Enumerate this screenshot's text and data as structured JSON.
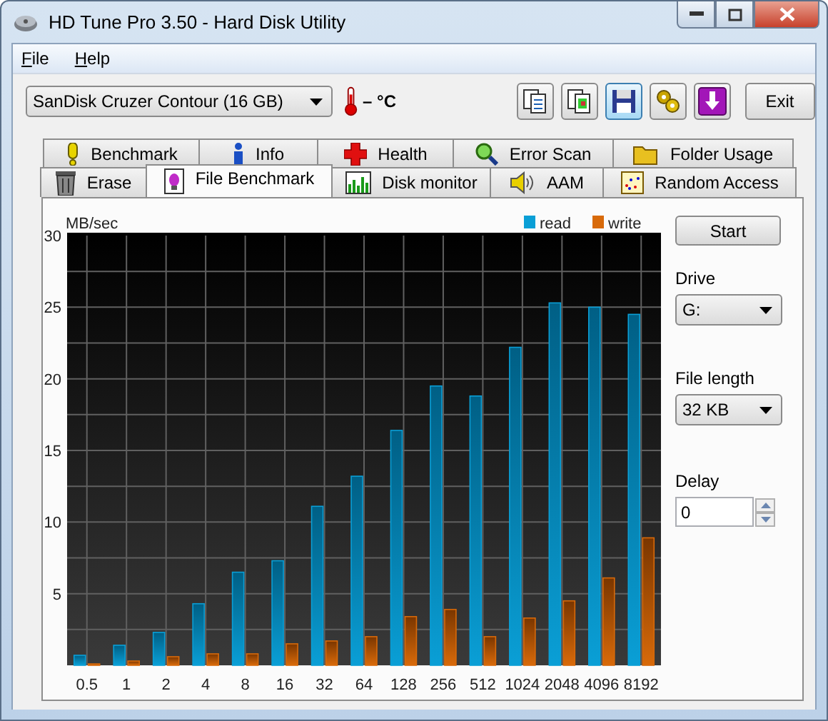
{
  "window": {
    "title": "HD Tune Pro 3.50 - Hard Disk Utility"
  },
  "menu": [
    {
      "label": "File"
    },
    {
      "label": "Help"
    }
  ],
  "toolbar": {
    "drive": "SanDisk Cruzer Contour (16 GB)",
    "temperature": "– °C",
    "exit": "Exit"
  },
  "tab_rows": [
    {
      "tabs": [
        {
          "label": "Benchmark",
          "selected": false
        },
        {
          "label": "Info",
          "selected": false
        },
        {
          "label": "Health",
          "selected": false
        },
        {
          "label": "Error Scan",
          "selected": false
        },
        {
          "label": "Folder Usage",
          "selected": false
        }
      ]
    },
    {
      "tabs": [
        {
          "label": "Erase",
          "selected": false
        },
        {
          "label": "File Benchmark",
          "selected": true
        },
        {
          "label": "Disk monitor",
          "selected": false
        },
        {
          "label": "AAM",
          "selected": false
        },
        {
          "label": "Random Access",
          "selected": false
        }
      ]
    }
  ],
  "panel": {
    "chart_data": {
      "type": "bar",
      "ylabel": "MB/sec",
      "categories": [
        "0.5",
        "1",
        "2",
        "4",
        "8",
        "16",
        "32",
        "64",
        "128",
        "256",
        "512",
        "1024",
        "2048",
        "4096",
        "8192"
      ],
      "series": [
        {
          "name": "read",
          "color": "#0a9fd6",
          "values": [
            0.7,
            1.4,
            2.3,
            4.3,
            6.5,
            7.3,
            11.1,
            13.2,
            16.4,
            19.5,
            18.8,
            22.2,
            25.3,
            25.0,
            24.5
          ]
        },
        {
          "name": "write",
          "color": "#d86a0a",
          "values": [
            0.1,
            0.3,
            0.6,
            0.8,
            0.8,
            1.5,
            1.7,
            2.0,
            3.4,
            3.9,
            2.0,
            3.3,
            4.5,
            6.1,
            8.9
          ]
        }
      ],
      "ylim": [
        0,
        30
      ],
      "yticks": [
        5,
        10,
        15,
        20,
        25,
        30
      ],
      "grid": true,
      "legend": true
    },
    "start": "Start",
    "drive": {
      "label": "Drive",
      "value": "G:"
    },
    "file_length": {
      "label": "File length",
      "value": "32 KB"
    },
    "delay": {
      "label": "Delay",
      "value": "0"
    }
  }
}
